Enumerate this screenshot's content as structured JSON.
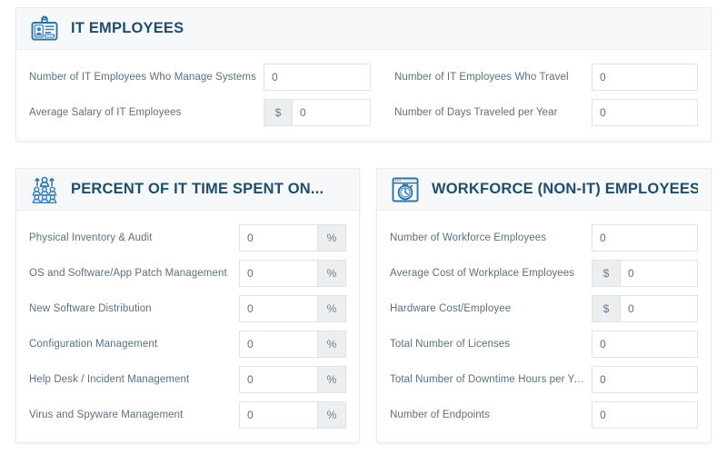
{
  "cards": {
    "it_employees": {
      "title": "IT EMPLOYEES",
      "icon": "id-badge-icon",
      "left_fields": [
        {
          "label": "Number of IT Employees Who Manage Systems",
          "value": "0",
          "prefix": "",
          "suffix": ""
        },
        {
          "label": "Average Salary of IT Employees",
          "value": "0",
          "prefix": "$",
          "suffix": ""
        }
      ],
      "right_fields": [
        {
          "label": "Number of IT Employees Who Travel",
          "value": "0",
          "prefix": "",
          "suffix": ""
        },
        {
          "label": "Number of Days Traveled per Year",
          "value": "0",
          "prefix": "",
          "suffix": ""
        }
      ]
    },
    "percent_it_time": {
      "title": "PERCENT OF IT TIME SPENT ON...",
      "icon": "people-group-growth-icon",
      "fields": [
        {
          "label": "Physical Inventory & Audit",
          "value": "0",
          "prefix": "",
          "suffix": "%"
        },
        {
          "label": "OS and Software/App Patch Management",
          "value": "0",
          "prefix": "",
          "suffix": "%"
        },
        {
          "label": "New Software Distribution",
          "value": "0",
          "prefix": "",
          "suffix": "%"
        },
        {
          "label": "Configuration Management",
          "value": "0",
          "prefix": "",
          "suffix": "%"
        },
        {
          "label": "Help Desk / Incident Management",
          "value": "0",
          "prefix": "",
          "suffix": "%"
        },
        {
          "label": "Virus and Spyware Management",
          "value": "0",
          "prefix": "",
          "suffix": "%"
        }
      ]
    },
    "workforce_employees": {
      "title": "WORKFORCE (NON-IT) EMPLOYEES",
      "icon": "browser-stopwatch-icon",
      "fields": [
        {
          "label": "Number of Workforce Employees",
          "value": "0",
          "prefix": "",
          "suffix": ""
        },
        {
          "label": "Average Cost of Workplace Employees",
          "value": "0",
          "prefix": "$",
          "suffix": ""
        },
        {
          "label": "Hardware Cost/Employee",
          "value": "0",
          "prefix": "$",
          "suffix": ""
        },
        {
          "label": "Total Number of Licenses",
          "value": "0",
          "prefix": "",
          "suffix": ""
        },
        {
          "label": "Total Number of Downtime Hours per Year",
          "value": "0",
          "prefix": "",
          "suffix": ""
        },
        {
          "label": "Number of Endpoints",
          "value": "0",
          "prefix": "",
          "suffix": ""
        }
      ]
    }
  },
  "colors": {
    "title": "#1f4e6d",
    "label": "#5c7080",
    "icon": "#2a73a8",
    "header_bg": "#f7f8f9",
    "border": "#e9ecef",
    "addon_bg": "#eceef0"
  }
}
